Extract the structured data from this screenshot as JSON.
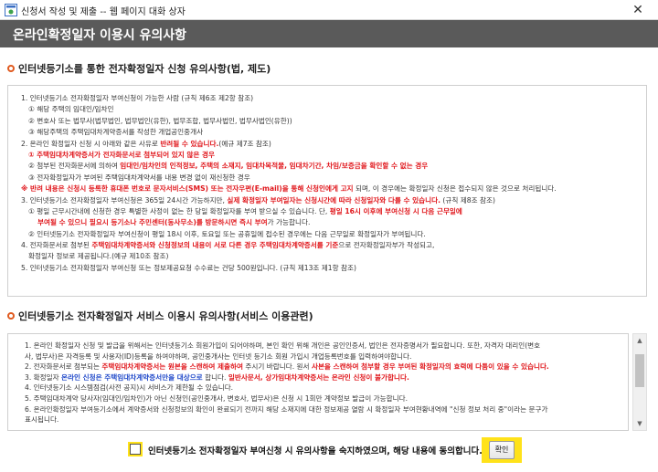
{
  "window": {
    "title": "신청서 작성 및 제출 -- 웹 페이지 대화 상자",
    "close_label": "✕"
  },
  "header": {
    "title": "온라인확정일자 이용시 유의사항"
  },
  "section1": {
    "title": "인터넷등기소를 통한 전자확정일자 신청 유의사항(법, 제도)",
    "lines": [
      "1. 인터넷등기소 전자확정일자 부여신청이 가능한 사람 (규칙 제6조 제2항 참조)",
      "① 해당 주택의 임대인/임차인",
      "② 변호사 또는 법무사(법무법인, 법무법인(유한), 법무조합, 법무사법인, 법무사법인(유한))",
      "③ 해당주택의 주택임대차계약증서를 작성한 개업공인중개사",
      "2. 온라인 확정일자 신청 시 아래와 같은 사유로 ",
      "반려될 수 있습니다.",
      "(예규 제7조 참조)",
      "① 주택임대차계약증서가 전자화문서로 첨부되어 있지 않은 경우",
      "② 첨부된 전자화문서에 의하여 ",
      "임대인/임차인의 인적정보, 주택의 소재지, 임대차목적물, 임대차기간, 차임/보증금을 확인할 수 없는 경우",
      "③ 전자확정일자가 부여된 주택임대차계약서를 내용 변경 없이 재신청한 경우",
      "※ 반려 내용은 신청시 등록한 휴대폰 번호로 문자서비스(SMS) 또는 전자우편(E-mail)을 통해 신청인에게 고지",
      " 되며, 이 경우에는 확정일자 신청은 접수되지 않은 것으로 처리됩니다.",
      "3. 인터넷등기소 전자확정일자 부여신청은 365일 24시간 가능하지만, ",
      "실제 확정일자 부여일자는 신청시간에 따라 신청일자와 다를 수 있습니다.",
      " (규칙 제8조 참조)",
      "① 평일 근무시간내에 신청한 경우 특별한 사정이 없는 한 당일 확정일자를 부여 받으실 수 있습니다. 단, ",
      "평일 16시 이후에 부여신청 시 다음 근무일에",
      "부여될 수 있으니 필요시 등기소나 주민센터(동사무소)를 방문하시면 즉시 부여",
      "가 가능합니다.",
      "② 인터넷등기소 전자확정일자 부여신청이 평일 18시 이후, 토요일 또는 공휴일에 접수된 경우에는 다음 근무일로 확정일자가 부여됩니다.",
      "4. 전자화문서로 첨부된 ",
      "주택임대차계약증서와 신청정보의 내용이 서로 다른 경우 주택임대차계약증서를 기준",
      "으로 전자확정일자부가 작성되고,",
      "확정일자 정보로 제공됩니다.",
      "(예규 제10조 참조)",
      "5. 인터넷등기소 전자확정일자 부여신청 또는 정보제공요청 수수료는 건당 500원입니다. (규칙 제13조 제1항 참조)"
    ]
  },
  "section2": {
    "title": "인터넷등기소 전자확정일자 서비스 이용시 유의사항(서비스 이용관련)",
    "lines": [
      "1. 온라인 확정일자 신청 및 발급을 위해서는 인터넷등기소 회원가입이 되어야하며, 본인 확인 위해 개인은 공인인증서, 법인은 전자증명서가 필요합니다. 또한, 자격자 대리인(변호",
      "사, 법무사)은 자격등록 및 사용자(ID)등록을 하여야하며, 공인중개사는 인터넷 등기소 회원 가입시 개업등록번호를 입력하여야합니다.",
      "2. 전자화문서로 첨부되는 ",
      "주택임대차계약증서는 원본을 스캔하여 제출하여",
      " 주시기 바랍니다. 원서 ",
      "사본을 스캔하여 첨부할 경우 부여된 확정일자의 효력에 다툼이 있을 수 있습니다.",
      "3. 확정일자 ",
      "온라인 신청은 주택임대차계약증서만을 대상으로",
      " 합니다. ",
      "일반사문서, 상가임대차계약증서는 온라인 신청이 불가합니다.",
      "4. 인터넷등기소 시스템점검(사전 공지)시 서비스가 제한될 수 있습니다.",
      "5. 주택임대차계약 당사자(임대인/임차인)가 아닌 신청인(공인중개사, 변호사, 법무사)은 신청 시 1회만 계약정보 발급이 가능합니다.",
      "6. 온라인확정일자 부여등기소에서 계약증서와 신청정보의 확인이 완료되기 전까지 해당 소재지에 대한 정보제공 열람 시 확정일자 부여현황내역에 \"신청 정보 처리 중\"이라는 문구가",
      "표시됩니다."
    ]
  },
  "consent": {
    "label": "인터넷등기소 전자확정일자 부여신청 시 유의사항을 숙지하였으며, 해당 내용에 동의합니다.",
    "checked": false
  },
  "confirm_button": "확인",
  "colors": {
    "header_bg": "#5a5a5a",
    "highlight": "#ffe21a",
    "warning_red": "#e0161b",
    "emphasis_blue": "#1f48c9",
    "bullet_orange": "#e05a1f"
  },
  "icons": [
    "app-window-icon",
    "close-icon",
    "section-bullet-icon",
    "scroll-up-arrow-icon",
    "scroll-down-arrow-icon"
  ]
}
